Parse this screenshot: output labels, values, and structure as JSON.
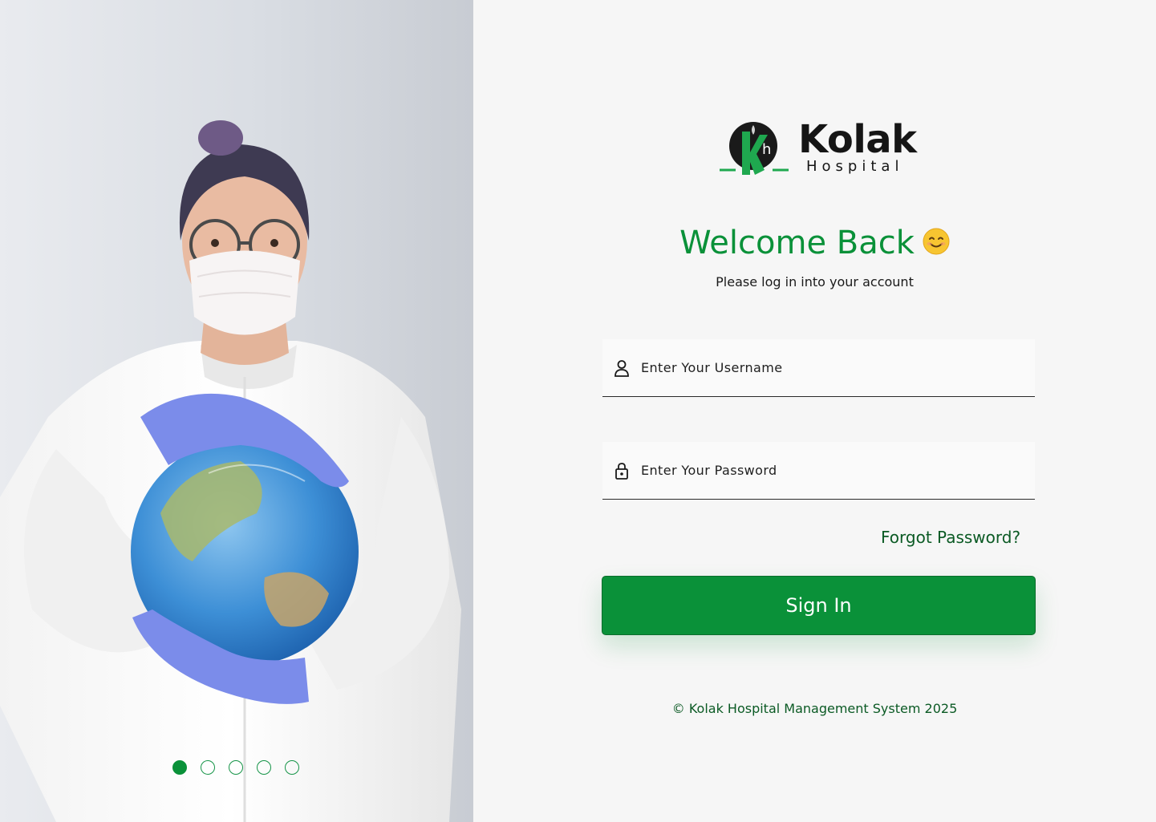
{
  "hero": {
    "image_alt": "Masked healthcare worker holding a globe",
    "carousel": {
      "count": 5,
      "active_index": 0
    }
  },
  "brand": {
    "name": "Kolak",
    "subtitle": "Hospital",
    "logo_letters": "Kh",
    "primary_color": "#0a9139",
    "dark_green": "#0b5a24"
  },
  "login": {
    "title": "Welcome Back",
    "subtitle": "Please log in into your account",
    "username": {
      "placeholder": "Enter Your Username",
      "value": ""
    },
    "password": {
      "placeholder": "Enter Your Password",
      "value": ""
    },
    "forgot_label": "Forgot Password?",
    "signin_label": "Sign In"
  },
  "footer": {
    "copyright": "© Kolak Hospital Management System 2025"
  },
  "icons": [
    "user-icon",
    "lock-icon",
    "smile-emoji-icon",
    "logo-icon"
  ]
}
